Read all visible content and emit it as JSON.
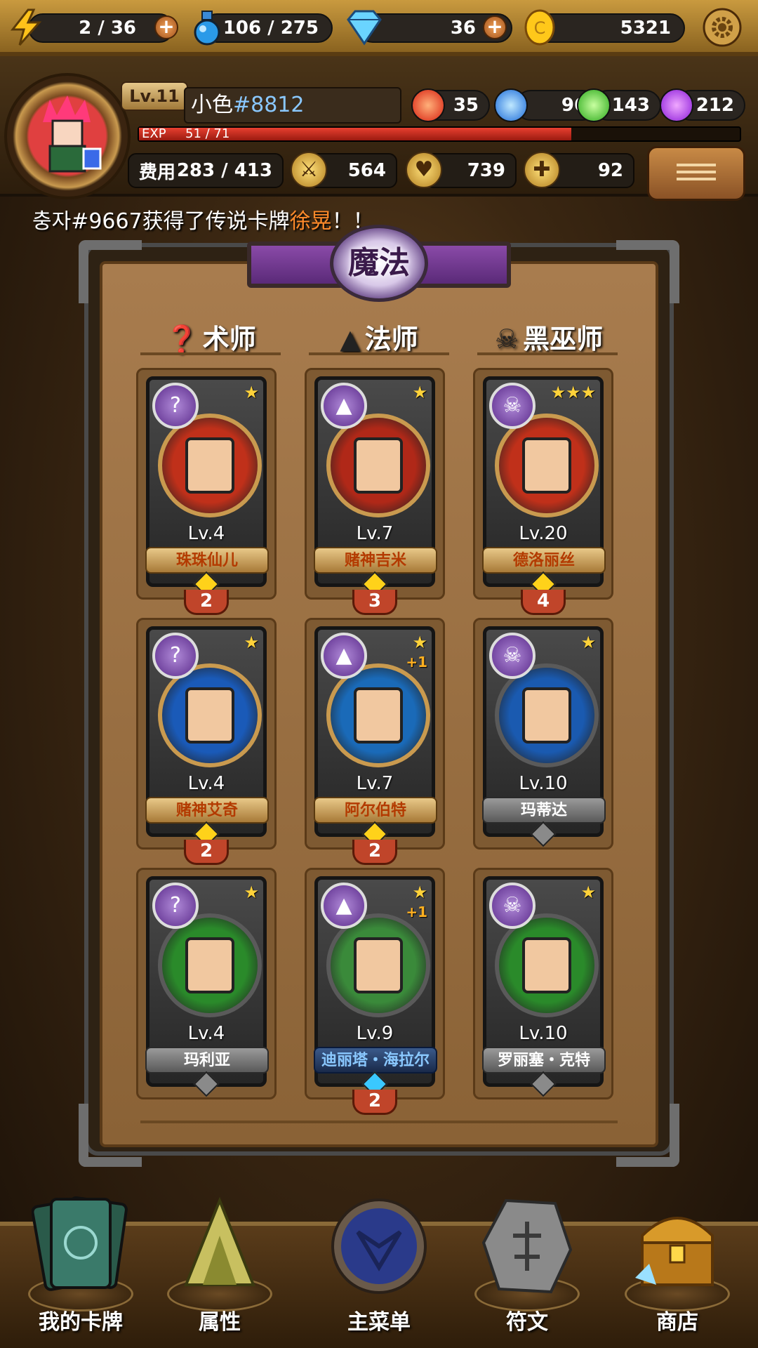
{
  "top_bar": {
    "energy": "2 / 36",
    "potion": "106 / 275",
    "diamonds": "36",
    "gold": "5321"
  },
  "profile": {
    "level": "Lv.11",
    "name": "小色",
    "tag": "#8812",
    "exp_label": "EXP",
    "exp_value": "51 / 71",
    "exp_fraction": 0.72,
    "gems": {
      "red": "35",
      "blue": "96",
      "green": "143",
      "purple": "212"
    },
    "cost_label": "费用",
    "cost": "283 / 413",
    "attack": "564",
    "defense": "739",
    "heal": "92"
  },
  "ticker": {
    "prefix": "충자#9667获得了传说卡牌",
    "highlight": "徐晃",
    "suffix": "！！"
  },
  "panel": {
    "title": "魔法",
    "columns": [
      "术师",
      "法师",
      "黑巫师"
    ]
  },
  "cards": [
    {
      "class_icon": "?",
      "stars": "★",
      "plus": "",
      "level": "Lv.4",
      "name": "珠珠仙儿",
      "style": "gold",
      "count": "2",
      "portrait": "#c0301a"
    },
    {
      "class_icon": "▲",
      "stars": "★",
      "plus": "",
      "level": "Lv.7",
      "name": "赌神吉米",
      "style": "gold",
      "count": "3",
      "portrait": "#b02818"
    },
    {
      "class_icon": "☠",
      "stars": "★★★",
      "plus": "",
      "level": "Lv.20",
      "name": "德洛丽丝",
      "style": "gold",
      "count": "4",
      "portrait": "#c0301a"
    },
    {
      "class_icon": "?",
      "stars": "★",
      "plus": "",
      "level": "Lv.4",
      "name": "赌神艾奇",
      "style": "gold",
      "count": "2",
      "portrait": "#1a5ab8"
    },
    {
      "class_icon": "▲",
      "stars": "★",
      "plus": "+1",
      "level": "Lv.7",
      "name": "阿尔伯特",
      "style": "gold",
      "count": "2",
      "portrait": "#1a6ab8"
    },
    {
      "class_icon": "☠",
      "stars": "★",
      "plus": "",
      "level": "Lv.10",
      "name": "玛蒂达",
      "style": "grey",
      "count": "",
      "portrait": "#1a5ab0"
    },
    {
      "class_icon": "?",
      "stars": "★",
      "plus": "",
      "level": "Lv.4",
      "name": "玛利亚",
      "style": "grey",
      "count": "",
      "portrait": "#2a8a2a"
    },
    {
      "class_icon": "▲",
      "stars": "★",
      "plus": "+1",
      "level": "Lv.9",
      "name": "迪丽塔・海拉尔",
      "style": "blue",
      "count": "2",
      "portrait": "#3a8a3a"
    },
    {
      "class_icon": "☠",
      "stars": "★",
      "plus": "",
      "level": "Lv.10",
      "name": "罗丽塞・克特",
      "style": "grey",
      "count": "",
      "portrait": "#2a8a2a"
    }
  ],
  "nav": [
    "我的卡牌",
    "属性",
    "主菜单",
    "符文",
    "商店"
  ]
}
